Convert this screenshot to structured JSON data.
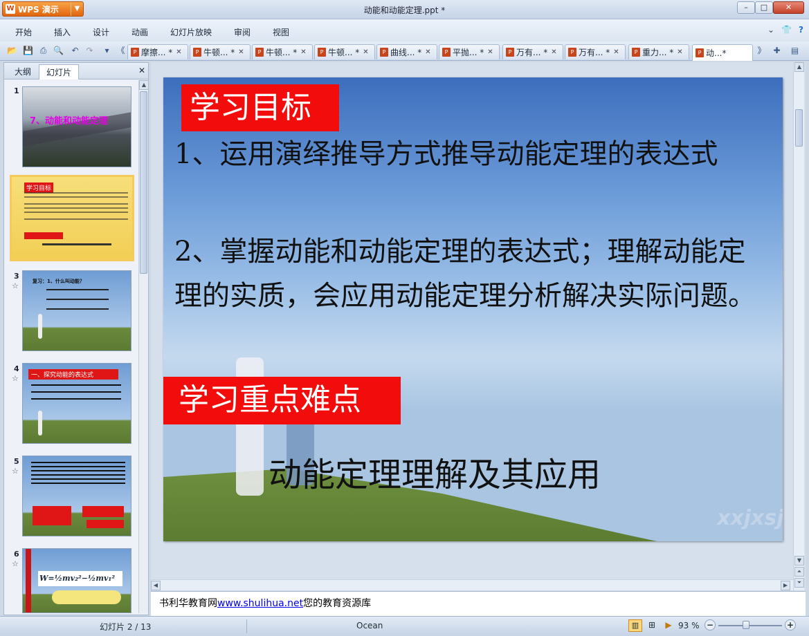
{
  "app": {
    "name": "WPS 演示",
    "title": "动能和动能定理.ppt *"
  },
  "window_buttons": {
    "minimize": "–",
    "maximize": "□",
    "close": "✕"
  },
  "menu": [
    "开始",
    "插入",
    "设计",
    "动画",
    "幻灯片放映",
    "审阅",
    "视图"
  ],
  "menu_right": {
    "chevron": "⌄",
    "skin": "👕",
    "help": "?"
  },
  "toolbar": {
    "icons": [
      "open-icon",
      "save-icon",
      "print-icon",
      "preview-icon",
      "undo-icon",
      "redo-icon",
      "customize-icon",
      "tab-scroll-left-icon"
    ]
  },
  "doc_tabs": [
    {
      "label": "摩擦... *",
      "close": "✕"
    },
    {
      "label": "牛顿... *",
      "close": "✕"
    },
    {
      "label": "牛顿... *",
      "close": "✕"
    },
    {
      "label": "牛顿... *",
      "close": "✕"
    },
    {
      "label": "曲线... *",
      "close": "✕"
    },
    {
      "label": "平抛... *",
      "close": "✕"
    },
    {
      "label": "万有... *",
      "close": "✕"
    },
    {
      "label": "万有... *",
      "close": "✕"
    },
    {
      "label": "重力... *",
      "close": "✕"
    },
    {
      "label": "动...*",
      "close": ""
    }
  ],
  "left_pane": {
    "tabs": [
      "大纲",
      "幻灯片"
    ],
    "close": "✕",
    "slides": [
      {
        "num": "1",
        "star": "",
        "caption": "7、动能和动能定理"
      },
      {
        "num": "2",
        "star": "",
        "caption": "学习目标"
      },
      {
        "num": "3",
        "star": "☆",
        "caption": "复习：1、什么叫动能？"
      },
      {
        "num": "4",
        "star": "☆",
        "caption": "一、探究动能的表达式"
      },
      {
        "num": "5",
        "star": "☆",
        "caption": ""
      },
      {
        "num": "6",
        "star": "☆",
        "caption": "W=½mv₂²−½mv₁²"
      }
    ]
  },
  "slide": {
    "heading1": "学习目标",
    "point1": "1、运用演绎推导方式推导动能定理的表达式",
    "point2": "2、掌握动能和动能定理的表达式；理解动能定理的实质，会应用动能定理分析解决实际问题。",
    "heading2": "学习重点难点",
    "keypoint": "动能定理理解及其应用",
    "watermark": "xxjxsj"
  },
  "notes": {
    "prefix": "书利华教育网",
    "link": "www.shulihua.net",
    "suffix": "您的教育资源库"
  },
  "status": {
    "slide_info": "幻灯片 2 / 13",
    "theme": "Ocean",
    "zoom": "93 %",
    "zoom_level_percent": 93
  }
}
